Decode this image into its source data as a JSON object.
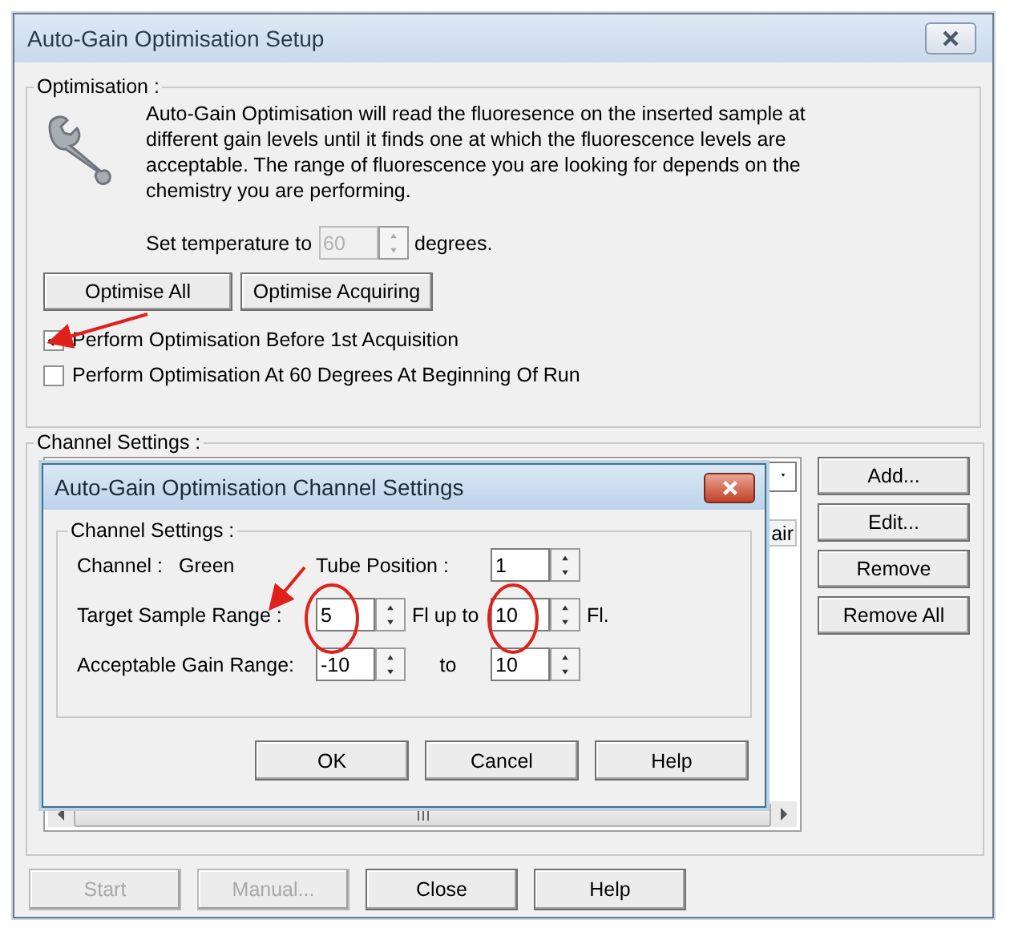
{
  "window": {
    "title": "Auto-Gain Optimisation Setup"
  },
  "optimisation": {
    "legend": "Optimisation :",
    "description": "Auto-Gain Optimisation will read the fluoresence on the inserted sample at different gain levels until it finds one at which the fluorescence levels are acceptable. The range of fluorescence you are looking for depends on the chemistry you are performing.",
    "temperature": {
      "label": "Set temperature to",
      "value": "60",
      "disabled": true,
      "unit": "degrees."
    },
    "buttons": [
      {
        "label": "Optimise All"
      },
      {
        "label": "Optimise Acquiring"
      }
    ],
    "checkboxes": [
      {
        "label": "Perform Optimisation Before 1st Acquisition",
        "checked": true
      },
      {
        "label": "Perform Optimisation At 60 Degrees At Beginning Of Run",
        "checked": false
      }
    ]
  },
  "channel_settings": {
    "legend": "Channel Settings :",
    "list": {
      "column_header": "air"
    },
    "buttons": [
      {
        "label": "Add..."
      },
      {
        "label": "Edit..."
      },
      {
        "label": "Remove"
      },
      {
        "label": "Remove All"
      }
    ]
  },
  "dialog": {
    "title": "Auto-Gain Optimisation Channel Settings",
    "legend": "Channel Settings :",
    "channel_label": "Channel :",
    "channel_value": "Green",
    "tube_label": "Tube Position :",
    "tube_value": "1",
    "target_label": "Target Sample Range :",
    "target_from": "5",
    "target_middle": "Fl up to",
    "target_to": "10",
    "target_unit": "Fl.",
    "gain_label": "Acceptable Gain Range:",
    "gain_from": "-10",
    "gain_middle": "to",
    "gain_to": "10",
    "buttons": [
      {
        "label": "OK"
      },
      {
        "label": "Cancel"
      },
      {
        "label": "Help"
      }
    ]
  },
  "footer_buttons": [
    {
      "label": "Start",
      "disabled": true
    },
    {
      "label": "Manual...",
      "disabled": true
    },
    {
      "label": "Close",
      "disabled": false
    },
    {
      "label": "Help",
      "disabled": false
    }
  ]
}
